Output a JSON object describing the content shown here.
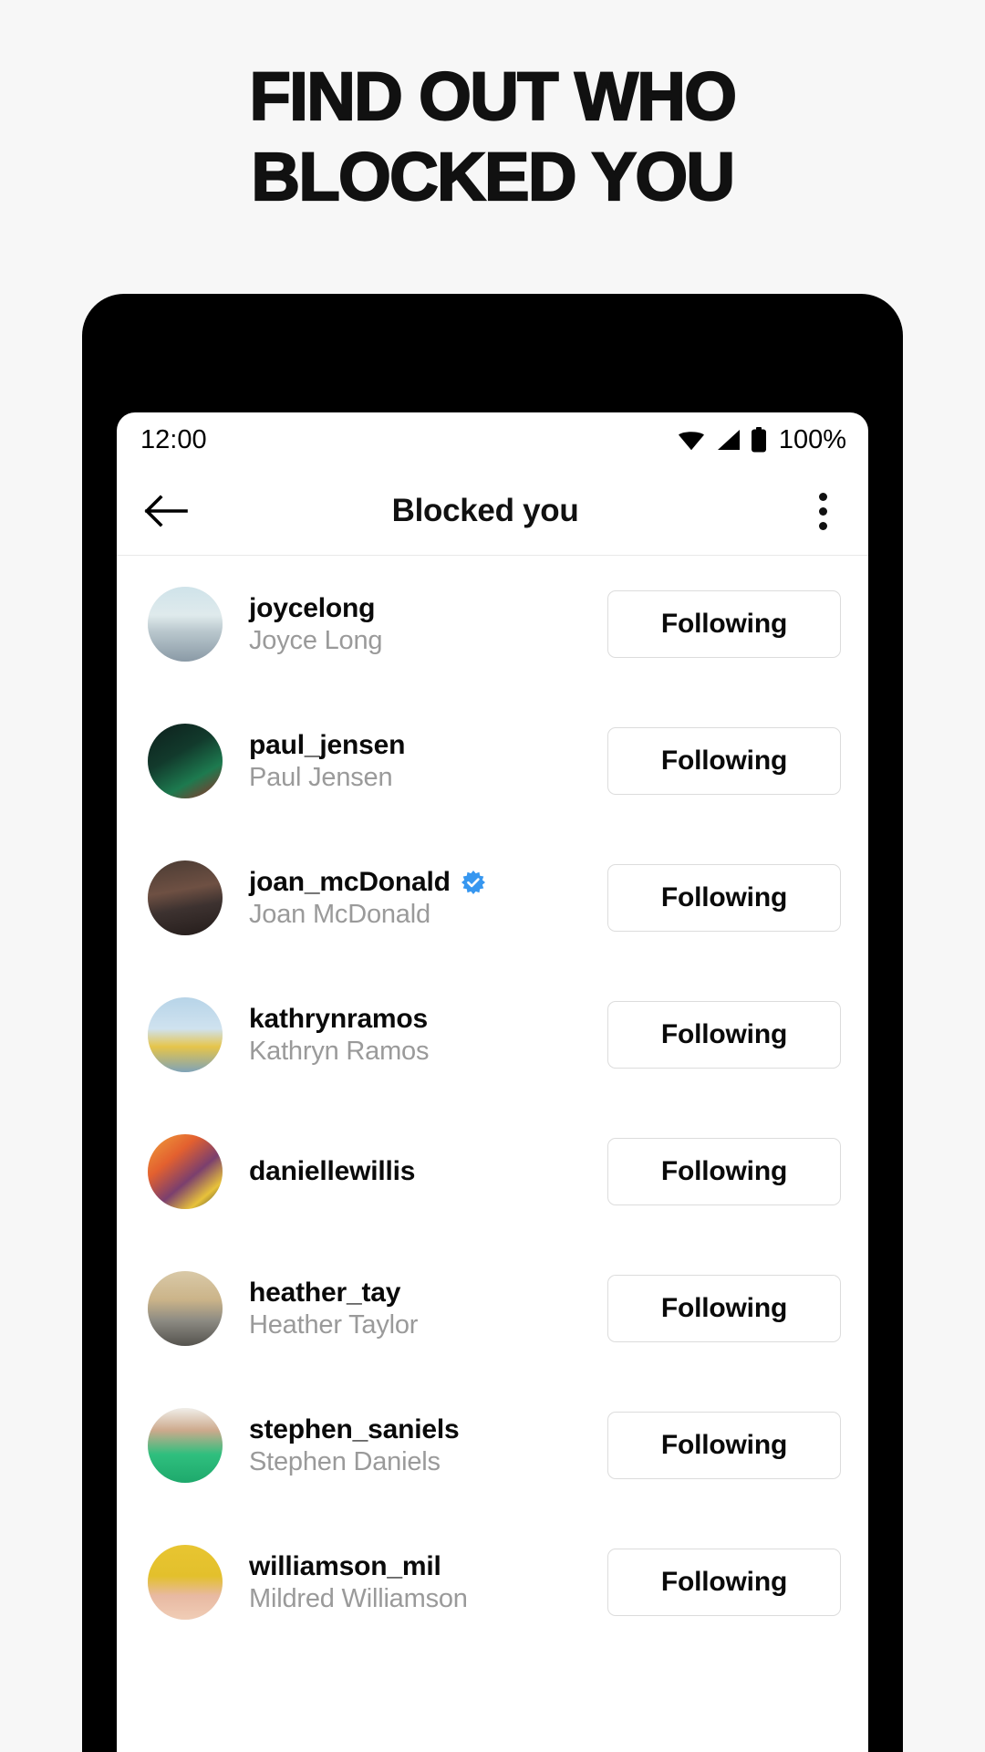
{
  "promo": {
    "headline_line1": "FIND OUT WHO",
    "headline_line2": "BLOCKED YOU",
    "background_color": "#f7f7f7",
    "text_color": "#111111"
  },
  "phone": {
    "bezel_color": "#000000",
    "screen_color": "#ffffff"
  },
  "status_bar": {
    "time": "12:00",
    "battery_text": "100%",
    "wifi_icon": "wifi-icon",
    "signal_icon": "cell-signal-icon",
    "battery_icon": "battery-full-icon"
  },
  "app_bar": {
    "back_icon": "back-arrow-icon",
    "title": "Blocked you",
    "overflow_icon": "overflow-menu-icon"
  },
  "follow_button_label": "Following",
  "verified_badge_color": "#3797f0",
  "users": [
    {
      "username": "joycelong",
      "fullname": "Joyce Long",
      "verified": false,
      "action": "Following",
      "avatar": "avatar-joycelong"
    },
    {
      "username": "paul_jensen",
      "fullname": "Paul Jensen",
      "verified": false,
      "action": "Following",
      "avatar": "avatar-paul-jensen"
    },
    {
      "username": "joan_mcDonald",
      "fullname": "Joan McDonald",
      "verified": true,
      "action": "Following",
      "avatar": "avatar-joan-mcdonald"
    },
    {
      "username": "kathrynramos",
      "fullname": "Kathryn Ramos",
      "verified": false,
      "action": "Following",
      "avatar": "avatar-kathrynramos"
    },
    {
      "username": "daniellewillis",
      "fullname": "",
      "verified": false,
      "action": "Following",
      "avatar": "avatar-daniellewillis"
    },
    {
      "username": "heather_tay",
      "fullname": "Heather Taylor",
      "verified": false,
      "action": "Following",
      "avatar": "avatar-heather-tay"
    },
    {
      "username": "stephen_saniels",
      "fullname": "Stephen Daniels",
      "verified": false,
      "action": "Following",
      "avatar": "avatar-stephen-saniels"
    },
    {
      "username": "williamson_mil",
      "fullname": "Mildred Williamson",
      "verified": false,
      "action": "Following",
      "avatar": "avatar-williamson-mil"
    }
  ]
}
